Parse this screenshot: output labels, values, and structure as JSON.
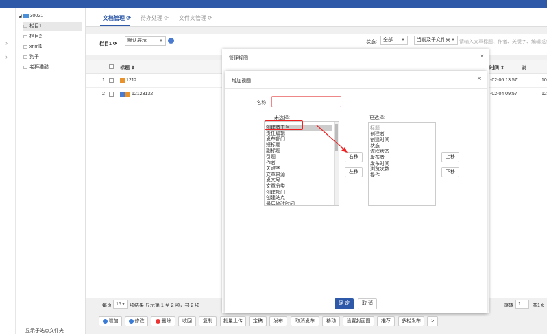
{
  "tree": {
    "root_label": "30021",
    "items": [
      {
        "label": "栏目1",
        "selected": true
      },
      {
        "label": "栏目2",
        "selected": false
      },
      {
        "label": "xnml1",
        "selected": false
      },
      {
        "label": "狗子",
        "selected": false
      },
      {
        "label": "老狮猫醋",
        "selected": false
      }
    ],
    "show_sub_label": "显示子站点文件夹"
  },
  "tabs": [
    {
      "label": "文档管理 ⟳"
    },
    {
      "label": "待办处理 ⟳"
    },
    {
      "label": "文件夹管理 ⟳"
    }
  ],
  "toolbar": {
    "column_label": "栏目1 ⟳",
    "view_select": "默认展示",
    "status_label": "状态:",
    "status_value": "全部",
    "scope_value": "当前及子文件夹",
    "search_placeholder": "请输入文章标题、作者、关键字、编辑或者"
  },
  "grid": {
    "col_title": "标题 ⇕",
    "col_time": "时间 ⇕",
    "col_views": "浏",
    "rows": [
      {
        "num": "1",
        "title": "1212",
        "time": "-02-06 13:57",
        "views": "10"
      },
      {
        "num": "2",
        "title": "12123132",
        "time": "-02-04 09:57",
        "views": "12"
      }
    ]
  },
  "pager": {
    "per_page_label": "每页",
    "per_page_value": "15",
    "summary": "项结果 显示第 1 至 2 项，共 2 项",
    "jump_label": "跳转",
    "jump_value": "1",
    "total_pages": "共1页"
  },
  "buttons": {
    "add": "增加",
    "edit": "修改",
    "delete": "删除",
    "recycle": "收回",
    "copy": "复制",
    "batch_upload": "批量上传",
    "finalize": "定稿",
    "publish": "发布",
    "unpublish": "取消发布",
    "move": "移动",
    "set_cover": "设置封面图",
    "recommend": "推荐",
    "multi_publish": "多栏发布",
    "more": ">"
  },
  "dialog_manage": {
    "title": "管理视图",
    "close": "×"
  },
  "dialog_add": {
    "title": "增加视图",
    "close": "×",
    "name_label": "名称:",
    "required_mark": "·",
    "unselected_label": "未选择:",
    "selected_label": "已选择:",
    "unselected_items": [
      "创建者工号",
      "责任编辑",
      "发布部门",
      "短标题",
      "副标题",
      "引题",
      "作者",
      "关键字",
      "文章来源",
      "发文号",
      "文章分类",
      "创建部门",
      "创建站点",
      "最后修改时间"
    ],
    "selected_items": [
      "标题",
      "创建者",
      "创建时间",
      "状态",
      "流程状态",
      "发布者",
      "发布时间",
      "浏览次数",
      "操作"
    ],
    "move_right": "右移",
    "move_left": "左移",
    "move_up": "上移",
    "move_down": "下移",
    "ok": "确 定",
    "cancel": "取 消"
  },
  "colors": {
    "primary": "#2e59a8",
    "highlight": "#e22222",
    "topbar": "#2e59a8"
  }
}
